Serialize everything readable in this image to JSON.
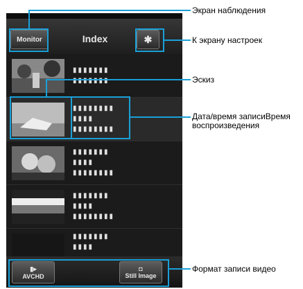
{
  "header": {
    "monitor_label": "Monitor",
    "title": "Index",
    "gear_icon": "gear-icon"
  },
  "rows": [
    {
      "dots1": "▮▮▮▮▮▮▮",
      "dots2": "▮▮▮▮▮▮▮"
    },
    {
      "dots1": "▮▮▮▮▮▮▮▮",
      "dots2": "▮▮▮▮",
      "dots3": "▮▮▮▮▮▮▮▮"
    },
    {
      "dots1": "▮▮▮▮▮▮▮",
      "dots2": "▮▮▮▮",
      "dots3": "▮▮▮▮▮▮▮▮"
    },
    {
      "dots1": "▮▮▮▮▮▮▮",
      "dots2": "▮▮▮▮",
      "dots3": "▮▮▮▮▮▮▮▮"
    },
    {
      "dots1": "▮▮▮▮▮▮▮",
      "dots2": "▮▮▮▮"
    }
  ],
  "footer": {
    "avchd_label": "AVCHD",
    "still_label": "Still Image"
  },
  "annotations": {
    "monitor_screen": "Экран наблюдения",
    "settings": "К экрану настроек",
    "thumbnail": "Эскиз",
    "datetime": "Дата/время записиВремя воспроизведения",
    "format": "Формат записи видео"
  },
  "colors": {
    "accent": "#1aa0d8"
  }
}
